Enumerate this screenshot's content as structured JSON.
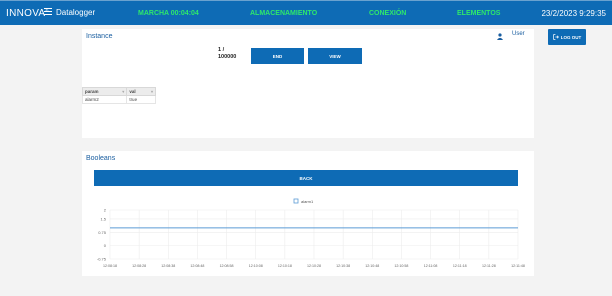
{
  "topbar": {
    "logo": "INNOVA",
    "app_name": "Datalogger",
    "nav": [
      {
        "label": "MARCHA 00:04:04"
      },
      {
        "label": "ALMACENAMIENTO"
      },
      {
        "label": "CONEXIÓN"
      },
      {
        "label": "ELEMENTOS"
      }
    ],
    "datetime": "23/2/2023 9:29:35",
    "logout_label": "LOG OUT"
  },
  "instance": {
    "title": "Instance",
    "user_label": "User",
    "counter_line1": "1 /",
    "counter_line2": "100000",
    "end_label": "END",
    "view_label": "VIEW",
    "table": {
      "headers": [
        "param",
        "val"
      ],
      "rows": [
        [
          "alarm2",
          "true"
        ]
      ]
    }
  },
  "booleans": {
    "title": "Booleans",
    "back_label": "BACK"
  },
  "colors": {
    "brand_blue": "#0e6bb5",
    "nav_green": "#2ee86b",
    "line": "#5b9bd5"
  },
  "chart_data": {
    "type": "line",
    "legend": [
      "alarm1"
    ],
    "x": [
      "12:08:18",
      "12:08:28",
      "12:08:38",
      "12:08:48",
      "12:08:58",
      "12:10:08",
      "12:10:18",
      "12:10:28",
      "12:10:38",
      "12:10:48",
      "12:10:58",
      "12:11:08",
      "12:11:18",
      "12:11:28",
      "12:11:48"
    ],
    "y_ticks": [
      "2",
      "1.5",
      "0.75",
      "0",
      "-0.75"
    ],
    "series": [
      {
        "name": "alarm1",
        "values": [
          1,
          1,
          1,
          1,
          1,
          1,
          1,
          1,
          1,
          1,
          1,
          1,
          1,
          1,
          1
        ]
      }
    ],
    "ylim": [
      -0.75,
      2
    ],
    "grid": true,
    "legend_position": "top-center"
  }
}
